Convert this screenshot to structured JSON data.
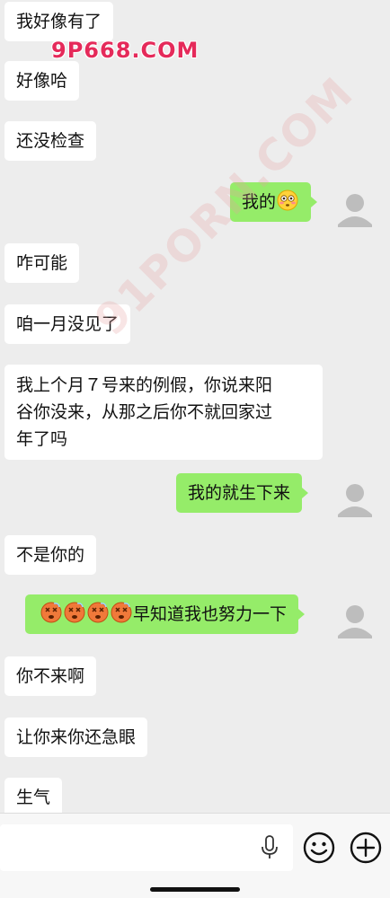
{
  "messages": [
    {
      "side": "left",
      "text": "我好像有了"
    },
    {
      "side": "left",
      "text": "好像哈"
    },
    {
      "side": "left",
      "text": "还没检查"
    },
    {
      "side": "right",
      "text": "我的",
      "emoji_suffix": "flushed-face"
    },
    {
      "side": "left",
      "text": "咋可能"
    },
    {
      "side": "left",
      "text": "咱一月没见了"
    },
    {
      "side": "left",
      "lines": [
        "我上个月７号来的例假，你说来阳",
        "谷你没来，从那之后你不就回家过",
        "年了吗"
      ]
    },
    {
      "side": "right",
      "text": "我的就生下来"
    },
    {
      "side": "left",
      "text": "不是你的"
    },
    {
      "side": "right",
      "emoji_prefix": [
        "dizzy-face",
        "dizzy-face",
        "dizzy-face",
        "dizzy-face"
      ],
      "text": "早知道我也努力一下"
    },
    {
      "side": "left",
      "text": "你不来啊"
    },
    {
      "side": "left",
      "text": "让你来你还急眼"
    },
    {
      "side": "left",
      "text": "生气"
    }
  ],
  "watermarks": {
    "top": "9P668.COM",
    "diagonal": "91PORN.COM"
  },
  "input_bar": {
    "value": "",
    "icons": [
      "microphone-icon",
      "emoji-icon",
      "plus-icon"
    ]
  },
  "colors": {
    "background": "#ededed",
    "sent_bubble": "#95ec69",
    "received_bubble": "#ffffff"
  }
}
